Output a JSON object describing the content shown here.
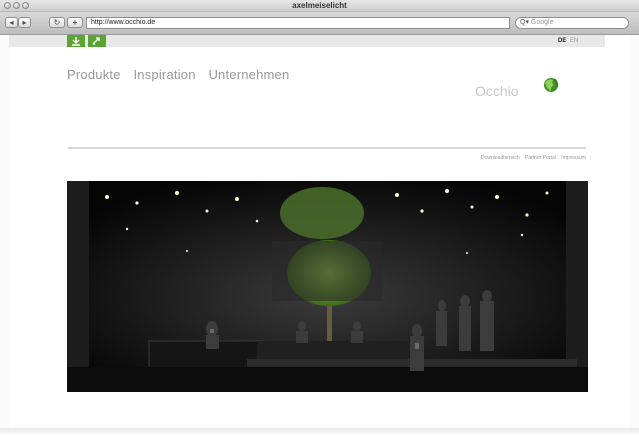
{
  "window": {
    "title": "axelmeiselicht"
  },
  "toolbar": {
    "back": "◂",
    "forward": "▸",
    "reload": "↻",
    "add": "+",
    "url": "http://www.occhio.de",
    "search_placeholder": "Google"
  },
  "langbar": {
    "languages": [
      "DE",
      "EN"
    ],
    "active_language": "DE"
  },
  "nav": {
    "items": [
      "Produkte",
      "Inspiration",
      "Unternehmen"
    ]
  },
  "logo": {
    "text": "Occhio"
  },
  "footer_links": [
    "Downloadbereich",
    "Partner Portal",
    "Impressum"
  ],
  "colors": {
    "brand_green": "#5aa532",
    "nav_text": "#9a9a9a",
    "photo_dark": "#0a0a0a"
  },
  "icons": {
    "download": "download-icon",
    "share": "share-icon",
    "logo": "occhio-logo-icon",
    "search": "search-icon"
  }
}
